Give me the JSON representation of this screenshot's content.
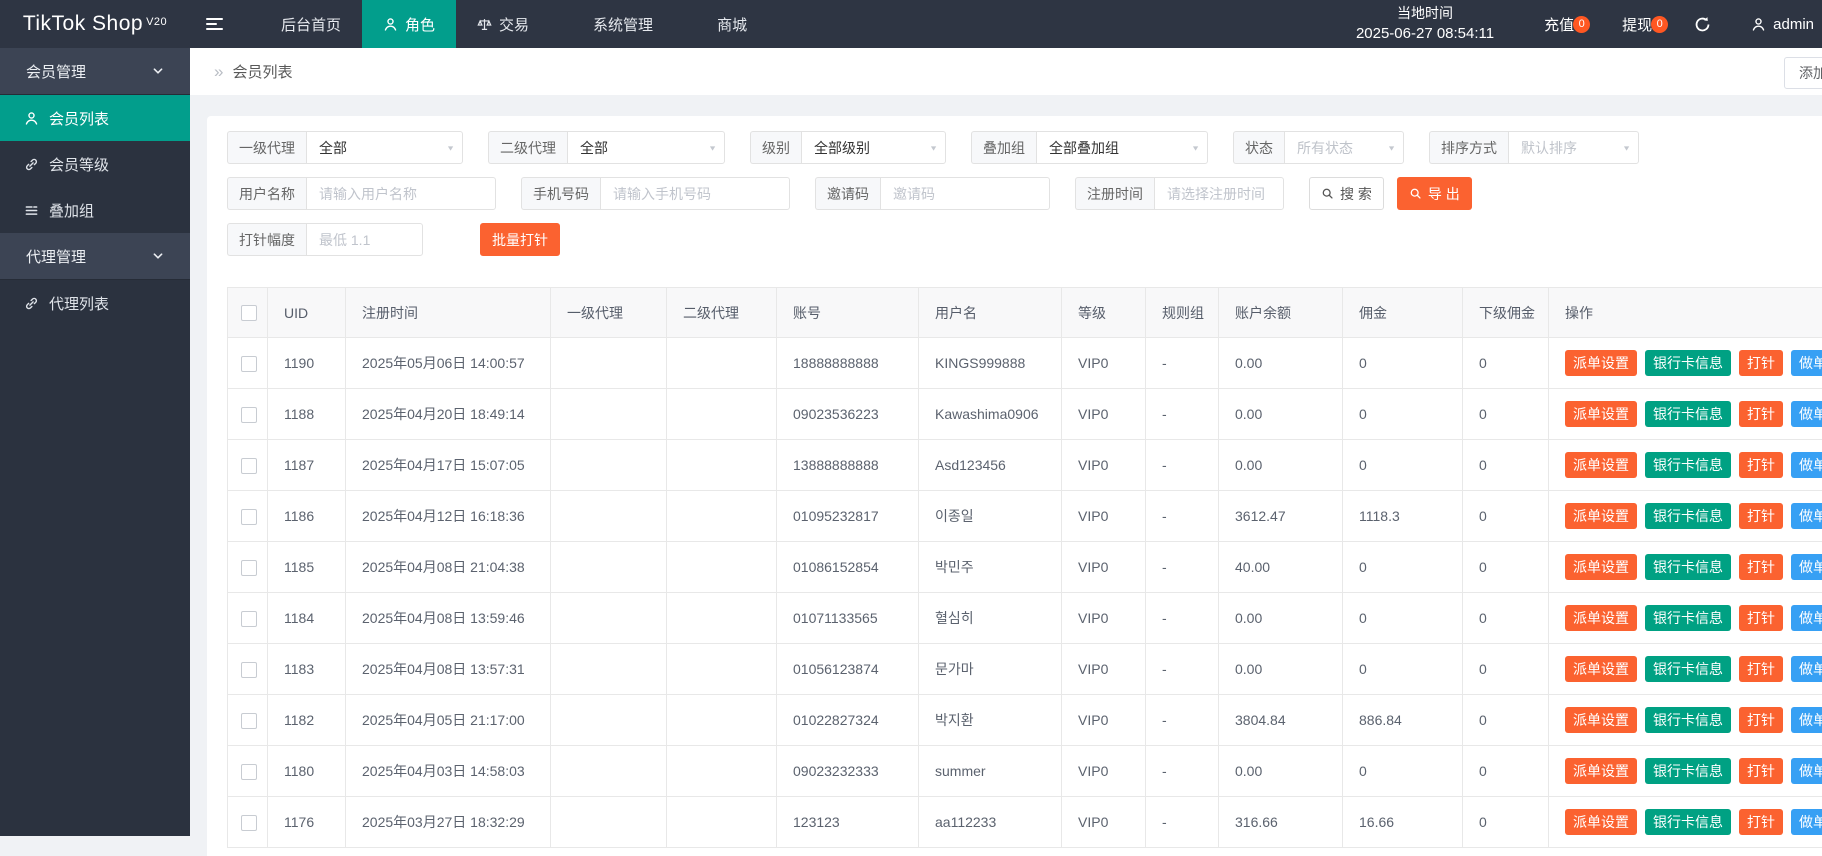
{
  "brand": {
    "name": "TikTok Shop",
    "version": "V20"
  },
  "navbar": {
    "items": [
      {
        "id": "dashboard",
        "label": "后台首页",
        "icon": null,
        "active": false
      },
      {
        "id": "roles",
        "label": "角色",
        "icon": "user",
        "active": true
      },
      {
        "id": "trade",
        "label": "交易",
        "icon": "scales",
        "active": false
      },
      {
        "id": "system",
        "label": "系统管理",
        "icon": null,
        "active": false
      },
      {
        "id": "mall",
        "label": "商城",
        "icon": null,
        "active": false
      }
    ],
    "local_time_label": "当地时间",
    "local_time_value": "2025-06-27 08:54:11",
    "recharge": {
      "label": "充值",
      "badge": "0"
    },
    "withdraw": {
      "label": "提现",
      "badge": "0"
    },
    "user_name": "admin"
  },
  "sidebar": {
    "groups": [
      {
        "label": "会员管理",
        "items": [
          {
            "label": "会员列表",
            "icon": "user",
            "active": true
          },
          {
            "label": "会员等级",
            "icon": "link",
            "active": false
          },
          {
            "label": "叠加组",
            "icon": "list",
            "active": false
          }
        ]
      },
      {
        "label": "代理管理",
        "items": [
          {
            "label": "代理列表",
            "icon": "link",
            "active": false
          }
        ]
      }
    ]
  },
  "breadcrumb": {
    "title": "会员列表"
  },
  "add_member_button": "添加会员",
  "filters": {
    "selects": [
      {
        "label": "一级代理",
        "value": "全部",
        "muted": false
      },
      {
        "label": "二级代理",
        "value": "全部",
        "muted": false
      },
      {
        "label": "级别",
        "value": "全部级别",
        "muted": false
      },
      {
        "label": "叠加组",
        "value": "全部叠加组",
        "muted": false
      },
      {
        "label": "状态",
        "value": "所有状态",
        "muted": true
      },
      {
        "label": "排序方式",
        "value": "默认排序",
        "muted": true
      }
    ],
    "inputs": [
      {
        "label": "用户名称",
        "placeholder": "请输入用户名称"
      },
      {
        "label": "手机号码",
        "placeholder": "请输入手机号码"
      },
      {
        "label": "邀请码",
        "placeholder": "邀请码"
      },
      {
        "label": "注册时间",
        "placeholder": "请选择注册时间"
      }
    ],
    "search_button": "搜 索",
    "export_button": "导 出",
    "injection": {
      "label": "打针幅度",
      "placeholder": "最低 1.1",
      "button": "批量打针"
    }
  },
  "table": {
    "columns": [
      "UID",
      "注册时间",
      "一级代理",
      "二级代理",
      "账号",
      "用户名",
      "等级",
      "规则组",
      "账户余额",
      "佣金",
      "下级佣金",
      "操作"
    ],
    "actions": [
      {
        "label": "派单设置",
        "type": "orange"
      },
      {
        "label": "银行卡信息",
        "type": "teal"
      },
      {
        "label": "打针",
        "type": "orange"
      },
      {
        "label": "做单",
        "type": "blue"
      },
      {
        "label": "...",
        "type": "more"
      }
    ],
    "rows": [
      {
        "uid": "1190",
        "reg_time": "2025年05月06日 14:00:57",
        "agent1": "",
        "agent2": "",
        "account": "18888888888",
        "username": "KINGS999888",
        "level": "VIP0",
        "rule_group": "-",
        "balance": "0.00",
        "commission": "0",
        "sub_commission": "0"
      },
      {
        "uid": "1188",
        "reg_time": "2025年04月20日 18:49:14",
        "agent1": "",
        "agent2": "",
        "account": "09023536223",
        "username": "Kawashima0906",
        "level": "VIP0",
        "rule_group": "-",
        "balance": "0.00",
        "commission": "0",
        "sub_commission": "0"
      },
      {
        "uid": "1187",
        "reg_time": "2025年04月17日 15:07:05",
        "agent1": "",
        "agent2": "",
        "account": "13888888888",
        "username": "Asd123456",
        "level": "VIP0",
        "rule_group": "-",
        "balance": "0.00",
        "commission": "0",
        "sub_commission": "0"
      },
      {
        "uid": "1186",
        "reg_time": "2025年04月12日 16:18:36",
        "agent1": "",
        "agent2": "",
        "account": "01095232817",
        "username": "이종일",
        "level": "VIP0",
        "rule_group": "-",
        "balance": "3612.47",
        "commission": "1118.3",
        "sub_commission": "0"
      },
      {
        "uid": "1185",
        "reg_time": "2025年04月08日 21:04:38",
        "agent1": "",
        "agent2": "",
        "account": "01086152854",
        "username": "박민주",
        "level": "VIP0",
        "rule_group": "-",
        "balance": "40.00",
        "commission": "0",
        "sub_commission": "0"
      },
      {
        "uid": "1184",
        "reg_time": "2025年04月08日 13:59:46",
        "agent1": "",
        "agent2": "",
        "account": "01071133565",
        "username": "혈심히",
        "level": "VIP0",
        "rule_group": "-",
        "balance": "0.00",
        "commission": "0",
        "sub_commission": "0"
      },
      {
        "uid": "1183",
        "reg_time": "2025年04月08日 13:57:31",
        "agent1": "",
        "agent2": "",
        "account": "01056123874",
        "username": "문가마",
        "level": "VIP0",
        "rule_group": "-",
        "balance": "0.00",
        "commission": "0",
        "sub_commission": "0"
      },
      {
        "uid": "1182",
        "reg_time": "2025年04月05日 21:17:00",
        "agent1": "",
        "agent2": "",
        "account": "01022827324",
        "username": "박지환",
        "level": "VIP0",
        "rule_group": "-",
        "balance": "3804.84",
        "commission": "886.84",
        "sub_commission": "0"
      },
      {
        "uid": "1180",
        "reg_time": "2025年04月03日 14:58:03",
        "agent1": "",
        "agent2": "",
        "account": "09023232333",
        "username": "summer",
        "level": "VIP0",
        "rule_group": "-",
        "balance": "0.00",
        "commission": "0",
        "sub_commission": "0"
      },
      {
        "uid": "1176",
        "reg_time": "2025年03月27日 18:32:29",
        "agent1": "",
        "agent2": "",
        "account": "123123",
        "username": "aa112233",
        "level": "VIP0",
        "rule_group": "-",
        "balance": "316.66",
        "commission": "16.66",
        "sub_commission": "0"
      }
    ]
  },
  "colors": {
    "accent_teal": "#029e8c",
    "action_orange": "#fb6230",
    "action_teal": "#00a183",
    "action_blue": "#37a0f4",
    "badge_orange": "#ff5722",
    "navbar_bg": "#2e3543",
    "sidebar_bg": "#2b323f"
  }
}
